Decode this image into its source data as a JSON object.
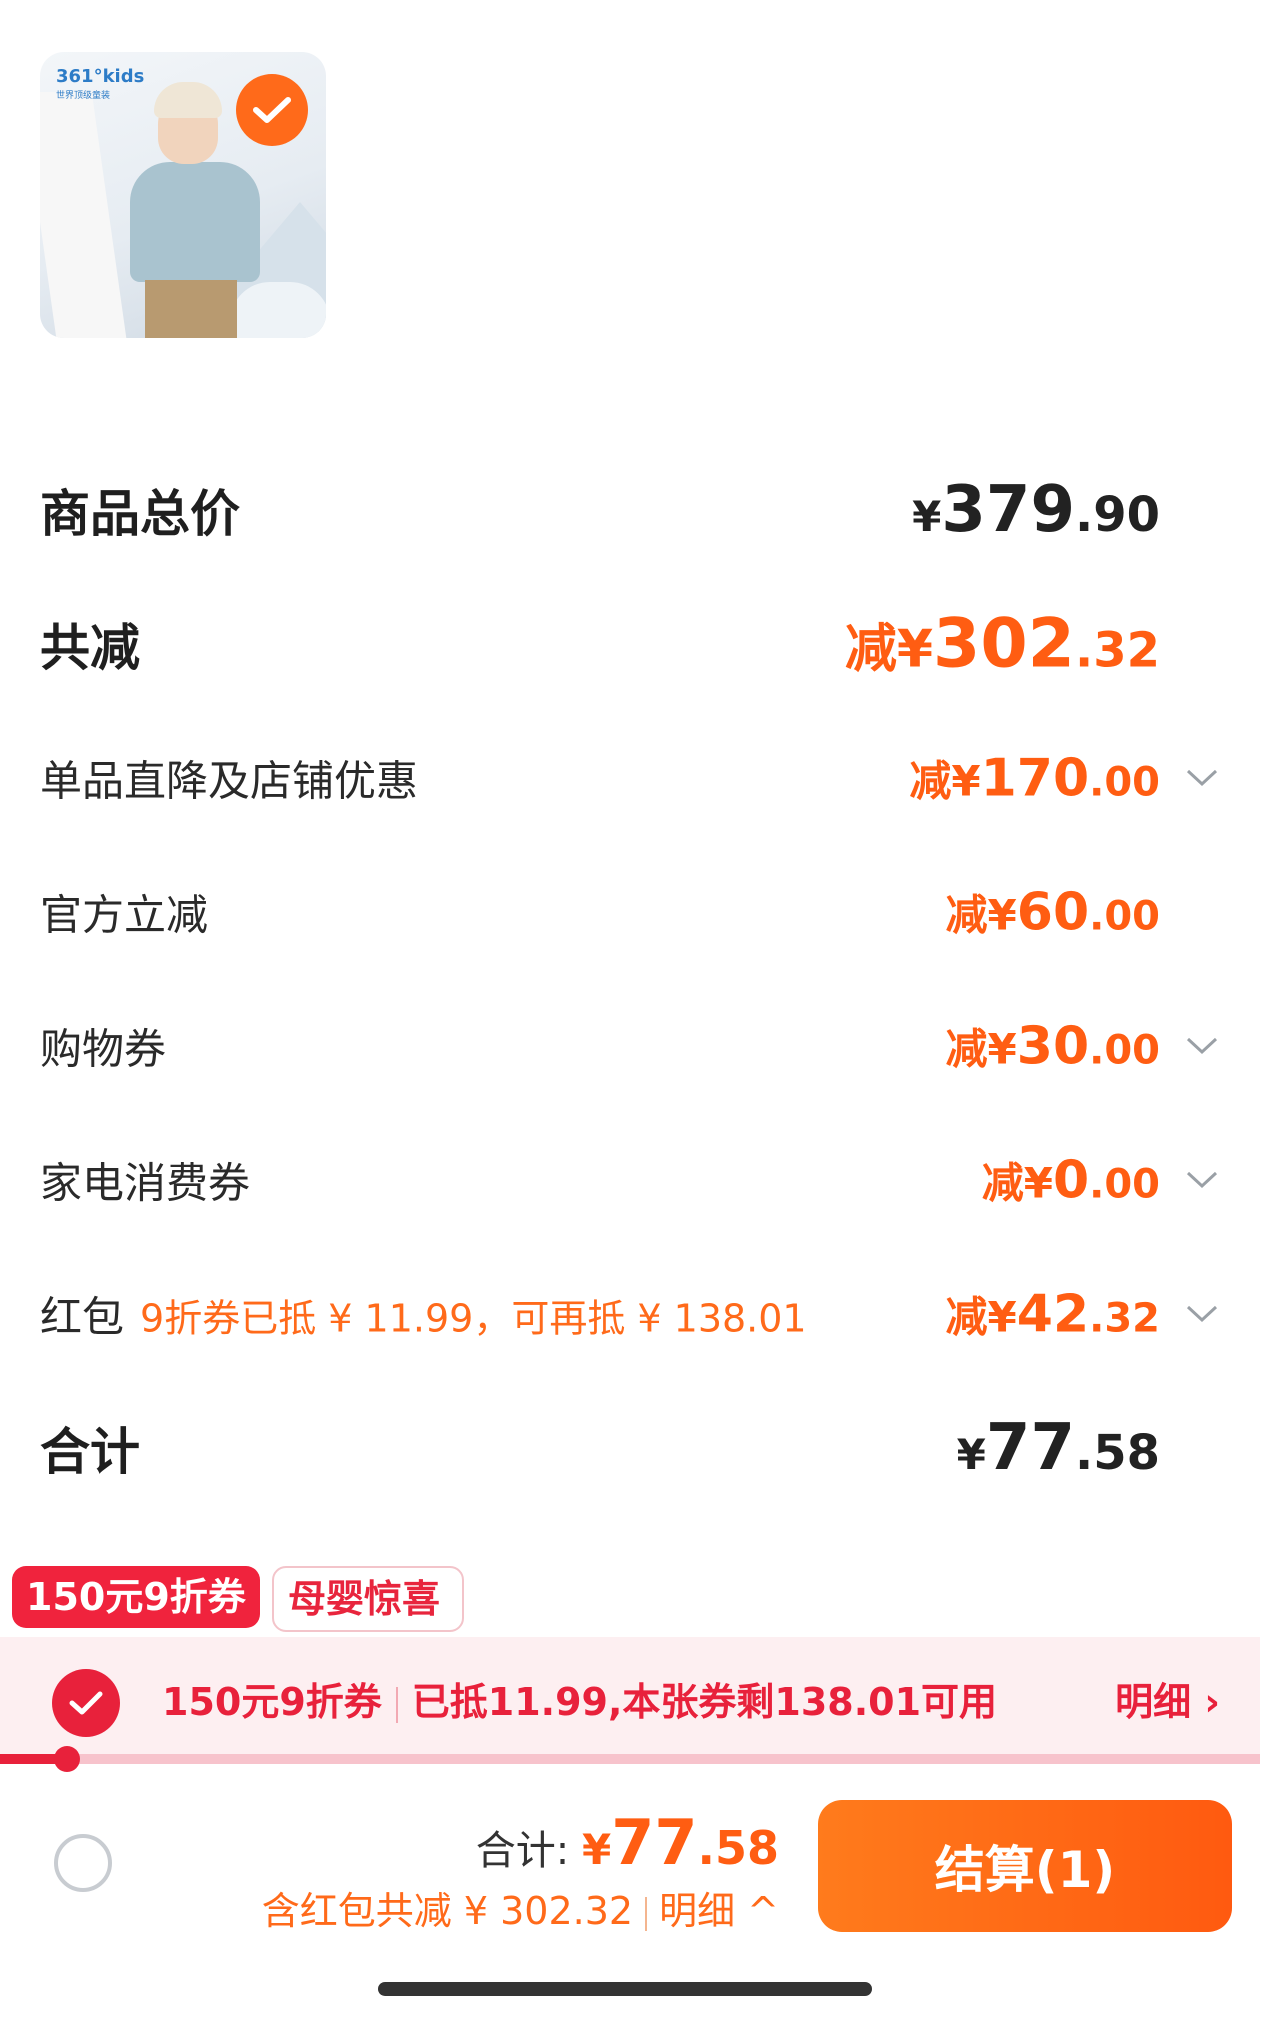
{
  "product": {
    "brand": "361°kids",
    "brand_sub": "世界顶级童装",
    "selected": true
  },
  "summary": {
    "goods_total_label": "商品总价",
    "goods_total_currency": "¥",
    "goods_total_int": "379",
    "goods_total_dec": ".90",
    "discount_label": "共减",
    "discount_prefix": "减¥",
    "discount_int": "302",
    "discount_dec": ".32",
    "rows": [
      {
        "label": "单品直降及店铺优惠",
        "prefix": "减¥",
        "int": "170",
        "dec": ".00",
        "has_chevron": true
      },
      {
        "label": "官方立减",
        "prefix": "减¥",
        "int": "60",
        "dec": ".00",
        "has_chevron": false
      },
      {
        "label": "购物券",
        "prefix": "减¥",
        "int": "30",
        "dec": ".00",
        "has_chevron": true
      },
      {
        "label": "家电消费券",
        "prefix": "减¥",
        "int": "0",
        "dec": ".00",
        "has_chevron": true
      },
      {
        "label": "红包",
        "note": "9折券已抵 ¥ 11.99，可再抵 ¥ 138.01",
        "prefix": "减¥",
        "int": "42",
        "dec": ".32",
        "has_chevron": true
      }
    ],
    "total_label": "合计",
    "total_currency": "¥",
    "total_int": "77",
    "total_dec": ".58"
  },
  "coupons": {
    "tag1": "150元9折券",
    "tag2": "母婴惊喜",
    "bar_name": "150元9折券",
    "bar_desc": "已抵11.99,本张券剩138.01可用",
    "bar_detail": "明细 ›",
    "progress_fraction": 0.053
  },
  "footer": {
    "total_label": "合计: ",
    "total_currency": "¥",
    "total_int": "77",
    "total_dec": ".58",
    "saved_text": "含红包共减 ¥ 302.32",
    "detail_text": "明细 ^",
    "checkout_label": "结算(1)"
  },
  "colors": {
    "accent_orange": "#ff5d12",
    "coupon_red": "#e8213b",
    "coupon_bg": "#fdeff1"
  }
}
